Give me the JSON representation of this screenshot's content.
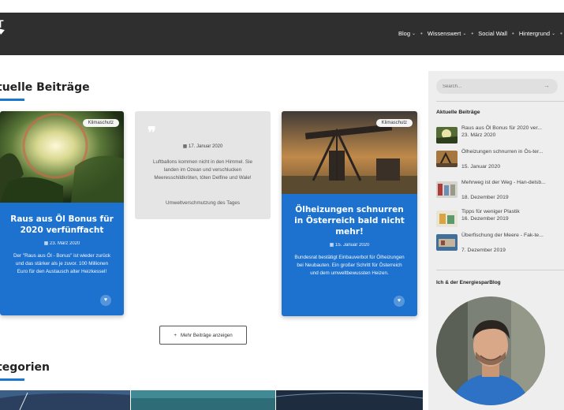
{
  "header": {
    "logo_text": "T",
    "nav": [
      {
        "label": "Blog",
        "dropdown": true
      },
      {
        "label": "Wissenswert",
        "dropdown": true
      },
      {
        "label": "Social Wall",
        "dropdown": false
      },
      {
        "label": "Hintergrund",
        "dropdown": true
      }
    ]
  },
  "posts_section": {
    "title": "tuelle Beiträge",
    "accent": "#1976d2"
  },
  "cards": [
    {
      "badge": "Klimaschutz",
      "title": "Raus aus Öl Bonus für 2020 verfünffacht",
      "date": "23. März 2020",
      "excerpt": "Der \"Raus aus Öl - Bonus\" ist wieder zurück und das stärker als je zuvor. 100 Millionen Euro für den Austausch alter Heizkessel!"
    },
    {
      "badge": "Klimaschutz",
      "title": "Ölheizungen schnurren in Österreich bald nicht mehr!",
      "date": "15. Januar 2020",
      "excerpt": "Bundesrat bestätigt Einbauverbot für Ölheizungen bei Neubauten. Ein großer Schritt für Österreich und dem umweltbewussten Heizen."
    }
  ],
  "quote_card": {
    "date": "17. Januar 2020",
    "text": "Luftballons kommen nicht in den Himmel. Sie landen im Ozean und verschlucken Meeresschildkröten, töten Delfine und Wale!",
    "source": "Umweltverschmutzung des Tages"
  },
  "more_button": {
    "icon": "+",
    "label": "Mehr Beiträge anzeigen"
  },
  "categories_section": {
    "title": "tegorien"
  },
  "sidebar": {
    "search_placeholder": "Search...",
    "recent_heading": "Aktuelle Beiträge",
    "recent_posts": [
      {
        "title": "Raus aus Öl Bonus für 2020 ver...",
        "date": "23. März 2020"
      },
      {
        "title": "Ölheizungen schnurren in Ös-ter...",
        "date": "15. Januar 2020"
      },
      {
        "title": "Mehrweg ist der Weg - Han-delsb...",
        "date": "18. Dezember 2019"
      },
      {
        "title": "Tipps für weniger Plastik",
        "date": "16. Dezember 2019"
      },
      {
        "title": "Überfischung der Meere - Fak-te...",
        "date": "7. Dezember 2019"
      }
    ],
    "about_heading": "Ich & der EnergiesparBlog"
  },
  "colors": {
    "navbar": "#2f2f2f",
    "card_blue": "#1d72d0",
    "sidebar_bg": "#eeeeee"
  }
}
